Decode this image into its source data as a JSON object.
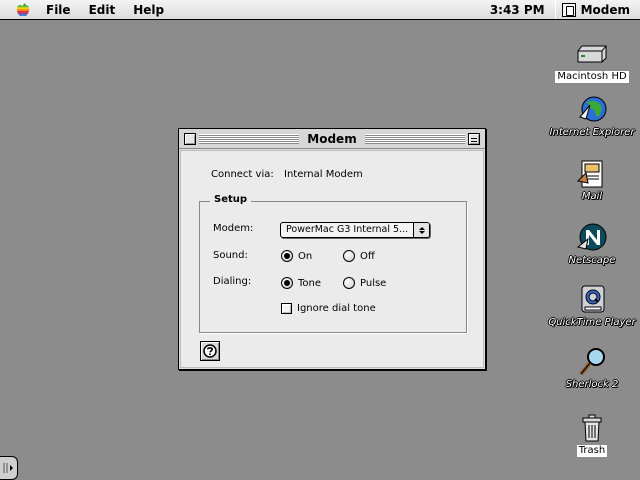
{
  "menubar": {
    "items": [
      "File",
      "Edit",
      "Help"
    ],
    "clock": "3:43 PM",
    "active_app": "Modem"
  },
  "desktop": {
    "icons": [
      {
        "label": "Macintosh HD",
        "icon": "hard-drive-icon"
      },
      {
        "label": "Internet Explorer",
        "icon": "globe-icon"
      },
      {
        "label": "Mail",
        "icon": "mail-icon"
      },
      {
        "label": "Netscape",
        "icon": "netscape-icon"
      },
      {
        "label": "QuickTime Player",
        "icon": "quicktime-icon"
      },
      {
        "label": "Sherlock 2",
        "icon": "magnifier-icon"
      },
      {
        "label": "Trash",
        "icon": "trash-icon"
      }
    ]
  },
  "window": {
    "title": "Modem",
    "connect_via_label": "Connect via:",
    "connect_via_value": "Internal Modem",
    "setup": {
      "title": "Setup",
      "modem_label": "Modem:",
      "modem_value": "PowerMac G3 Internal 5...",
      "sound_label": "Sound:",
      "sound_options": [
        "On",
        "Off"
      ],
      "sound_selected": "On",
      "dialing_label": "Dialing:",
      "dialing_options": [
        "Tone",
        "Pulse"
      ],
      "dialing_selected": "Tone",
      "ignore_dial_tone_label": "Ignore dial tone",
      "ignore_dial_tone_checked": false
    }
  }
}
